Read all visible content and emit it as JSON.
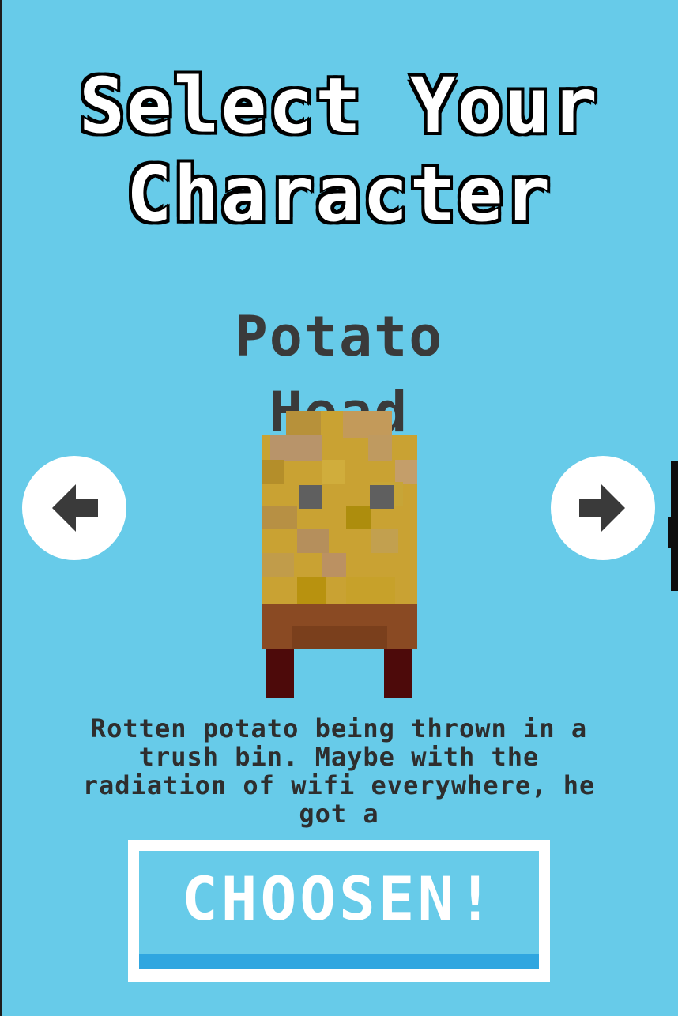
{
  "screen": {
    "title_line1": "Select Your",
    "title_line2": "Character"
  },
  "character": {
    "name_line1": "Potato",
    "name_line2": "Head",
    "description": "Rotten potato being thrown in a trush bin. Maybe with the radiation of wifi everywhere, he got a"
  },
  "navigation": {
    "prev_icon": "arrow-left-icon",
    "next_icon": "arrow-right-icon"
  },
  "action": {
    "choose_label": "CHOOSEN!"
  },
  "colors": {
    "background": "#67cbe9",
    "title_fill": "#ffffff",
    "title_outline": "#000000",
    "name_text": "#3a3a3a",
    "button_shade": "#2fa6e0"
  }
}
